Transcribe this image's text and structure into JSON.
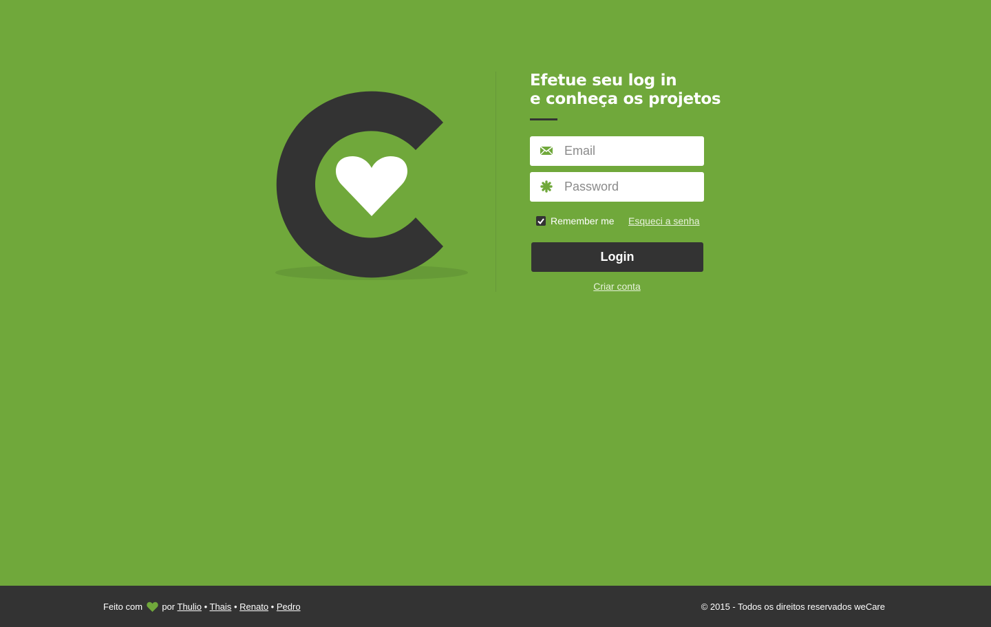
{
  "colors": {
    "background": "#70a83b",
    "dark": "#333333",
    "white": "#ffffff",
    "shadow": "#669a37"
  },
  "heading": {
    "line1_prefix": "Efetue seu ",
    "line1_bold": "log in",
    "line2": "e conheça os projetos"
  },
  "form": {
    "email": {
      "icon": "envelope-icon",
      "placeholder": "Email",
      "value": ""
    },
    "password": {
      "icon": "asterisk-icon",
      "placeholder": "Password",
      "value": ""
    },
    "remember": {
      "label": "Remember me",
      "checked": true
    },
    "forgot_label": "Esqueci a senha",
    "login_label": "Login",
    "create_account_label": "Criar conta"
  },
  "footer": {
    "made_with": "Feito com",
    "by": "por",
    "authors": [
      "Thulio",
      "Thais",
      "Renato",
      "Pedro"
    ],
    "separator": "•",
    "copyright": "© 2015 - Todos os direitos reservados weCare"
  }
}
